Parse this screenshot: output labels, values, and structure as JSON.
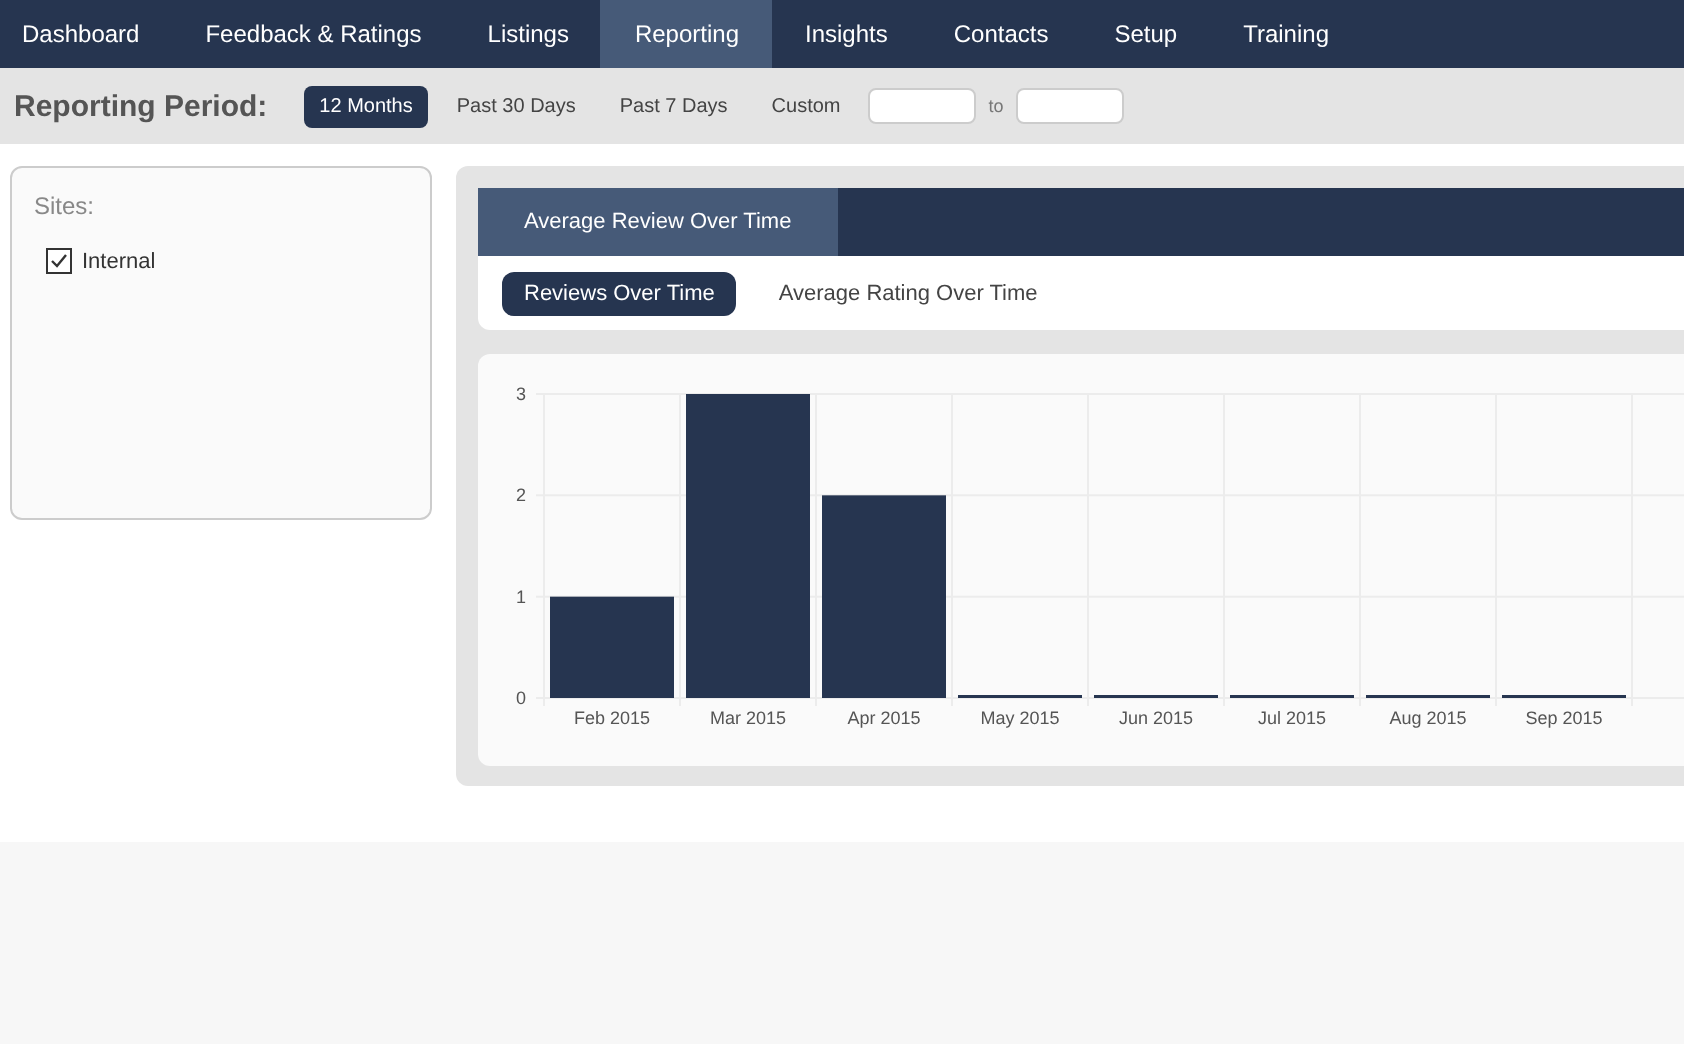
{
  "nav": [
    {
      "label": "Dashboard",
      "selected": false
    },
    {
      "label": "Feedback & Ratings",
      "selected": false
    },
    {
      "label": "Listings",
      "selected": false
    },
    {
      "label": "Reporting",
      "selected": true
    },
    {
      "label": "Insights",
      "selected": false
    },
    {
      "label": "Contacts",
      "selected": false
    },
    {
      "label": "Setup",
      "selected": false
    },
    {
      "label": "Training",
      "selected": false
    }
  ],
  "period": {
    "label": "Reporting Period:",
    "options": [
      {
        "label": "12 Months",
        "selected": true
      },
      {
        "label": "Past 30 Days",
        "selected": false
      },
      {
        "label": "Past 7 Days",
        "selected": false
      },
      {
        "label": "Custom",
        "selected": false
      }
    ],
    "to_label": "to"
  },
  "sites": {
    "title": "Sites:",
    "items": [
      {
        "label": "Internal",
        "checked": true
      }
    ]
  },
  "tabs": [
    {
      "label": "Average Review Over Time",
      "selected": true
    }
  ],
  "subtabs": [
    {
      "label": "Reviews Over Time",
      "selected": true
    },
    {
      "label": "Average Rating Over Time",
      "selected": false
    }
  ],
  "chart": {
    "chart_data": {
      "type": "bar",
      "categories": [
        "Feb 2015",
        "Mar 2015",
        "Apr 2015",
        "May 2015",
        "Jun 2015",
        "Jul 2015",
        "Aug 2015",
        "Sep 2015"
      ],
      "series": [
        {
          "color": "#263550",
          "values": [
            1,
            3,
            2,
            0,
            0,
            0,
            0,
            0
          ]
        }
      ],
      "ylim": [
        0,
        3
      ],
      "yticks": [
        0,
        1,
        2,
        3
      ]
    }
  }
}
